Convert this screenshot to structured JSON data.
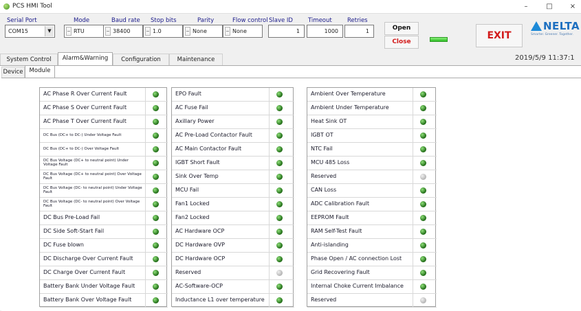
{
  "window": {
    "title": "PCS HMI Tool",
    "minimize": "–",
    "maximize": "□",
    "close": "×"
  },
  "connection": {
    "serial_port": {
      "label": "Serial Port",
      "value": "COM15"
    },
    "mode": {
      "label": "Mode",
      "value": "RTU"
    },
    "baud_rate": {
      "label": "Baud rate",
      "value": "38400"
    },
    "stop_bits": {
      "label": "Stop bits",
      "value": "1.0"
    },
    "parity": {
      "label": "Parity",
      "value": "None"
    },
    "flow_control": {
      "label": "Flow control",
      "value": "None"
    },
    "slave_id": {
      "label": "Slave ID",
      "value": "1"
    },
    "timeout": {
      "label": "Timeout",
      "value": "1000"
    },
    "retries": {
      "label": "Retries",
      "value": "1"
    },
    "open_label": "Open",
    "close_label": "Close",
    "status_color": "#2fbd26"
  },
  "exit_label": "EXIT",
  "logo": {
    "text": "NELTA",
    "tagline": "Smarter. Greener. Together."
  },
  "main_tabs": [
    "System Control",
    "Alarm&Warning",
    "Configuration",
    "Maintenance"
  ],
  "active_main_tab": "Alarm&Warning",
  "datetime": "2019/5/9 11:37:1",
  "sub_tabs": [
    "Device",
    "Module"
  ],
  "active_sub_tab": "Module",
  "led_colors": {
    "on": "#2f7d1f",
    "off": "#b4b4b4"
  },
  "alarm_columns": [
    [
      {
        "label": "AC Phase R Over Current Fault",
        "state": "on"
      },
      {
        "label": "AC Phase S Over Current Fault",
        "state": "on"
      },
      {
        "label": "AC Phase T Over Current Fault",
        "state": "on"
      },
      {
        "label": "DC Bus (DC+ to DC-) Under Voltage Fault",
        "state": "on",
        "small": true
      },
      {
        "label": "DC Bus (DC+ to DC-) Over Voltage Fault",
        "state": "on",
        "small": true
      },
      {
        "label": "DC Bus Voltage (DC+ to neutral point) Under Voltage Fault",
        "state": "on",
        "small": true
      },
      {
        "label": "DC Bus Voltage (DC+ to neutral point) Over Voltage Fault",
        "state": "on",
        "small": true
      },
      {
        "label": "DC Bus Voltage (DC- to neutral point) Under Voltage Fault",
        "state": "on",
        "small": true
      },
      {
        "label": "DC Bus Voltage (DC- to neutral point) Over Voltage Fault",
        "state": "on",
        "small": true
      },
      {
        "label": "DC Bus Pre-Load Fail",
        "state": "on"
      },
      {
        "label": "DC Side Soft-Start Fail",
        "state": "on"
      },
      {
        "label": "DC Fuse blown",
        "state": "on"
      },
      {
        "label": "DC Discharge Over Current Fault",
        "state": "on"
      },
      {
        "label": "DC Charge Over Current Fault",
        "state": "on"
      },
      {
        "label": "Battery Bank Under Voltage Fault",
        "state": "on"
      },
      {
        "label": "Battery Bank Over Voltage Fault",
        "state": "on"
      }
    ],
    [
      {
        "label": "EPO Fault",
        "state": "on"
      },
      {
        "label": "AC Fuse Fail",
        "state": "on"
      },
      {
        "label": "Axillary Power",
        "state": "on"
      },
      {
        "label": "AC Pre-Load Contactor Fault",
        "state": "on"
      },
      {
        "label": "AC Main Contactor Fault",
        "state": "on"
      },
      {
        "label": "IGBT Short Fault",
        "state": "on"
      },
      {
        "label": "Sink Over Temp",
        "state": "on"
      },
      {
        "label": "MCU Fail",
        "state": "on"
      },
      {
        "label": "Fan1 Locked",
        "state": "on"
      },
      {
        "label": "Fan2 Locked",
        "state": "on"
      },
      {
        "label": "AC Hardware OCP",
        "state": "on"
      },
      {
        "label": "DC Hardware OVP",
        "state": "on"
      },
      {
        "label": "DC Hardware OCP",
        "state": "on"
      },
      {
        "label": "Reserved",
        "state": "off"
      },
      {
        "label": "AC-Software-OCP",
        "state": "on"
      },
      {
        "label": "Inductance L1 over temperature",
        "state": "on"
      }
    ],
    [
      {
        "label": "Ambient Over Temperature",
        "state": "on"
      },
      {
        "label": "Ambient Under Temperature",
        "state": "on"
      },
      {
        "label": "Heat Sink OT",
        "state": "on"
      },
      {
        "label": "IGBT OT",
        "state": "on"
      },
      {
        "label": "NTC Fail",
        "state": "on"
      },
      {
        "label": "MCU 485 Loss",
        "state": "on"
      },
      {
        "label": "Reserved",
        "state": "off"
      },
      {
        "label": "CAN Loss",
        "state": "on"
      },
      {
        "label": "ADC Calibration Fault",
        "state": "on"
      },
      {
        "label": "EEPROM Fault",
        "state": "on"
      },
      {
        "label": "RAM Self-Test Fault",
        "state": "on"
      },
      {
        "label": "Anti-islanding",
        "state": "on"
      },
      {
        "label": "Phase Open / AC connection Lost",
        "state": "on"
      },
      {
        "label": "Grid Recovering Fault",
        "state": "on"
      },
      {
        "label": "Internal Choke Current Imbalance",
        "state": "on"
      },
      {
        "label": "Reserved",
        "state": "off"
      }
    ]
  ]
}
